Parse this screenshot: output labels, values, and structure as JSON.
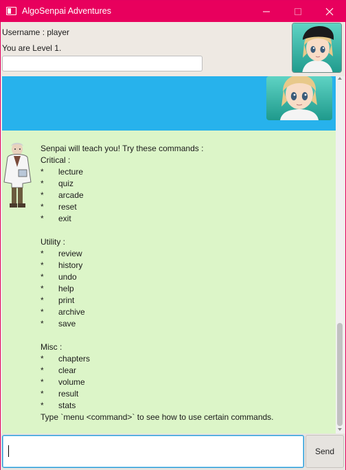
{
  "window": {
    "title": "AlgoSenpai Adventures",
    "accent_color": "#e8005d"
  },
  "header": {
    "username_text": "Username : player",
    "level_text": "You are Level 1.",
    "progress_fraction": 0.0,
    "progress_color": "#1fa3e0"
  },
  "chat": {
    "user_bubble_color": "#27b2ec",
    "background_color": "#dcf5c8",
    "senpai_message": {
      "intro": "Senpai will teach you! Try these commands :",
      "sections": [
        {
          "heading": "Critical :",
          "items": [
            "lecture",
            "quiz",
            "arcade",
            "reset",
            "exit"
          ]
        },
        {
          "heading": "Utility :",
          "items": [
            "review",
            "history",
            "undo",
            "help",
            "print",
            "archive",
            "save"
          ]
        },
        {
          "heading": "Misc :",
          "items": [
            "chapters",
            "clear",
            "volume",
            "result",
            "stats"
          ]
        }
      ],
      "bullet": "*",
      "footer": "Type `menu <command>` to see how to use certain commands."
    }
  },
  "input": {
    "value": "",
    "send_label": "Send"
  }
}
